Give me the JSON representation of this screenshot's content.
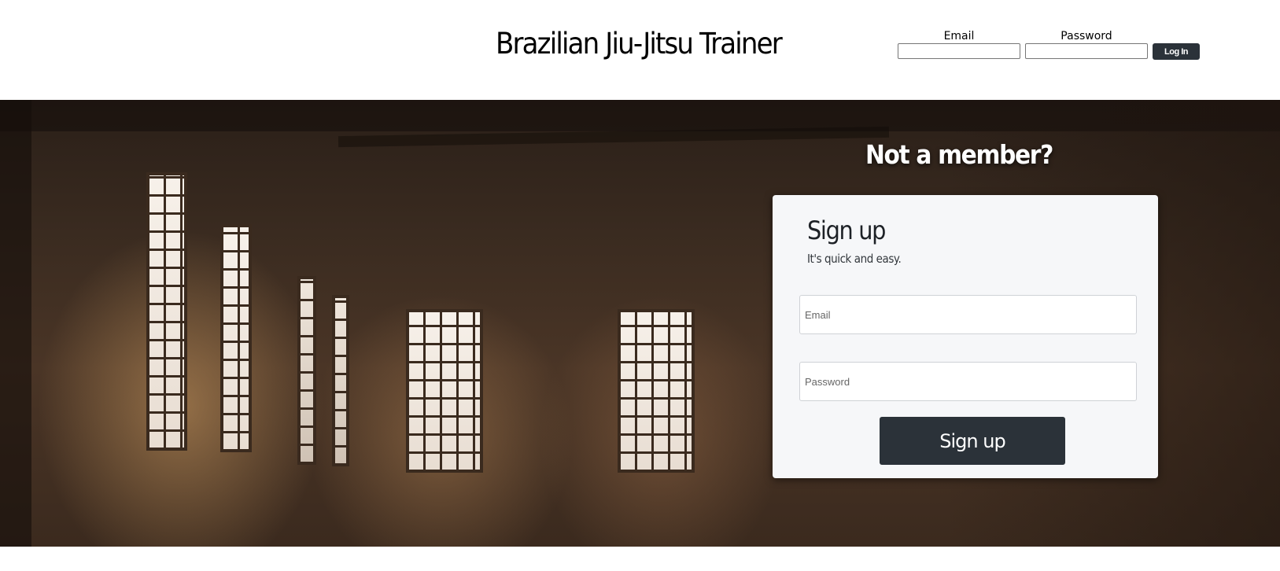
{
  "header": {
    "site_title": "Brazilian Jiu-Jitsu Trainer",
    "login": {
      "email_label": "Email",
      "password_label": "Password",
      "email_value": "",
      "password_value": "",
      "button_label": "Log In"
    }
  },
  "hero": {
    "heading": "Not a member?"
  },
  "signup": {
    "title": "Sign up",
    "subtitle": "It's quick and easy.",
    "email_placeholder": "Email",
    "password_placeholder": "Password",
    "button_label": "Sign up"
  },
  "colors": {
    "button_dark": "#2b3239",
    "card_background": "#f6f7f9"
  }
}
